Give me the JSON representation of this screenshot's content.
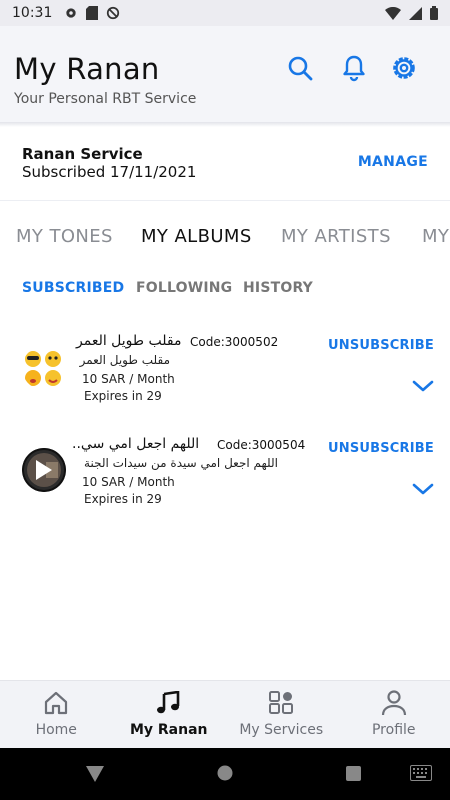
{
  "status_bar": {
    "time": "10:31"
  },
  "header": {
    "title": "My Ranan",
    "subtitle": "Your Personal RBT Service"
  },
  "service": {
    "name": "Ranan Service",
    "subscribed": "Subscribed 17/11/2021",
    "manage_label": "MANAGE"
  },
  "main_tabs": [
    "MY TONES",
    "MY ALBUMS",
    "MY ARTISTS",
    "MY"
  ],
  "active_main_tab": "MY ALBUMS",
  "sub_tabs": [
    "SUBSCRIBED",
    "FOLLOWING",
    "HISTORY"
  ],
  "active_sub_tab": "SUBSCRIBED",
  "albums": [
    {
      "title": "مقلب طويل العمر",
      "code": "Code:3000502",
      "description": "مقلب طويل العمر",
      "price": "10 SAR / Month",
      "expires": "Expires in 29",
      "action": "UNSUBSCRIBE",
      "art_icon": "emoji-faces-icon"
    },
    {
      "title": "اللهم اجعل امي سي..",
      "code": "Code:3000504",
      "description": "اللهم اجعل امي سيدة من سيدات الجنة",
      "price": "10 SAR / Month",
      "expires": "Expires in 29",
      "action": "UNSUBSCRIBE",
      "art_icon": "play-icon"
    }
  ],
  "bottom_nav": [
    {
      "label": "Home",
      "icon": "home-icon"
    },
    {
      "label": "My Ranan",
      "icon": "music-note-icon"
    },
    {
      "label": "My Services",
      "icon": "grid-icon"
    },
    {
      "label": "Profile",
      "icon": "person-icon"
    }
  ],
  "active_bottom_nav": "My Ranan",
  "colors": {
    "accent": "#1877e6",
    "header_bg": "#f4f5f9",
    "inactive_tab": "#8a8d93"
  }
}
